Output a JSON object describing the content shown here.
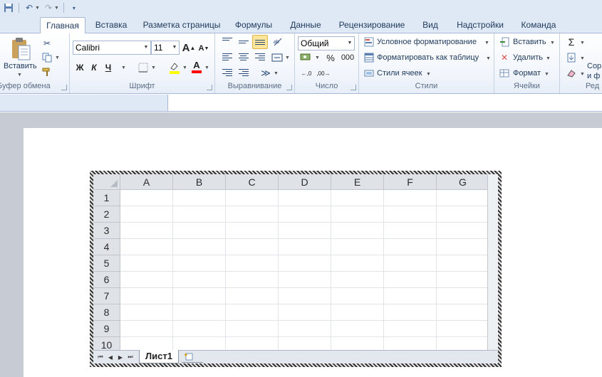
{
  "qat": {
    "save_icon": "save-icon",
    "undo_icon": "undo-icon",
    "redo_icon": "redo-icon",
    "customize_icon": "customize-icon"
  },
  "tabs": [
    {
      "label": "Главная",
      "active": true
    },
    {
      "label": "Вставка"
    },
    {
      "label": "Разметка страницы"
    },
    {
      "label": "Формулы"
    },
    {
      "label": "Данные"
    },
    {
      "label": "Рецензирование"
    },
    {
      "label": "Вид"
    },
    {
      "label": "Надстройки"
    },
    {
      "label": "Команда"
    }
  ],
  "ribbon": {
    "clipboard": {
      "paste_label": "Вставить",
      "group_label": "Буфер обмена"
    },
    "font": {
      "font_name": "Calibri",
      "font_size": "11",
      "bold": "Ж",
      "italic": "К",
      "underline": "Ч",
      "grow_font": "A",
      "shrink_font": "A",
      "font_color_letter": "A",
      "group_label": "Шрифт",
      "highlight_color": "#ffff00",
      "font_color": "#ff0000"
    },
    "alignment": {
      "group_label": "Выравнивание"
    },
    "number": {
      "format": "Общий",
      "percent": "%",
      "thousands": "000",
      "group_label": "Число"
    },
    "styles": {
      "conditional": "Условное форматирование",
      "format_table": "Форматировать как таблицу",
      "cell_styles": "Стили ячеек",
      "group_label": "Стили"
    },
    "cells": {
      "insert": "Вставить",
      "delete": "Удалить",
      "format": "Формат",
      "group_label": "Ячейки"
    },
    "editing": {
      "sum": "Σ",
      "sort_line1": "Сор",
      "sort_line2": "и ф",
      "group_label": "Ред"
    }
  },
  "sheet": {
    "columns": [
      "A",
      "B",
      "C",
      "D",
      "E",
      "F",
      "G"
    ],
    "rows": [
      "1",
      "2",
      "3",
      "4",
      "5",
      "6",
      "7",
      "8",
      "9",
      "10"
    ],
    "tab_name": "Лист1"
  },
  "colors": {
    "ribbon_bg": "#dfe9f5",
    "text": "#1e395b",
    "page_bg": "#c7ccd4"
  }
}
